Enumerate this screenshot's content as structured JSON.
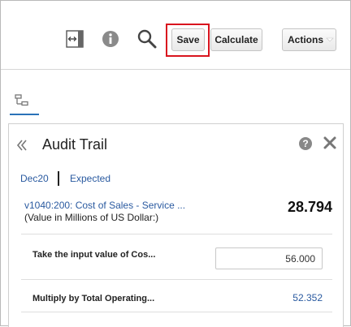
{
  "toolbar": {
    "expand_icon": "expand-horizontal-icon",
    "info_icon": "info-icon",
    "search_icon": "search-icon",
    "save_label": "Save",
    "calculate_label": "Calculate",
    "actions_label": "Actions"
  },
  "tabs": [
    {
      "icon": "hierarchy-icon",
      "active": true
    }
  ],
  "panel": {
    "title": "Audit Trail",
    "breadcrumb": [
      "Dec20",
      "Expected"
    ],
    "account_link": "v1040:200: Cost of Sales - Service ...",
    "account_units": "(Value in Millions of US Dollar:)",
    "account_value": "28.794",
    "rows": [
      {
        "label": "Take the input value of Cos...",
        "value": "56.000"
      },
      {
        "label": "Multiply by Total Operating...",
        "value": "52.352"
      }
    ]
  },
  "colors": {
    "link": "#2a5aa0",
    "highlight": "#d9141e",
    "tab_accent": "#2a72b8"
  }
}
